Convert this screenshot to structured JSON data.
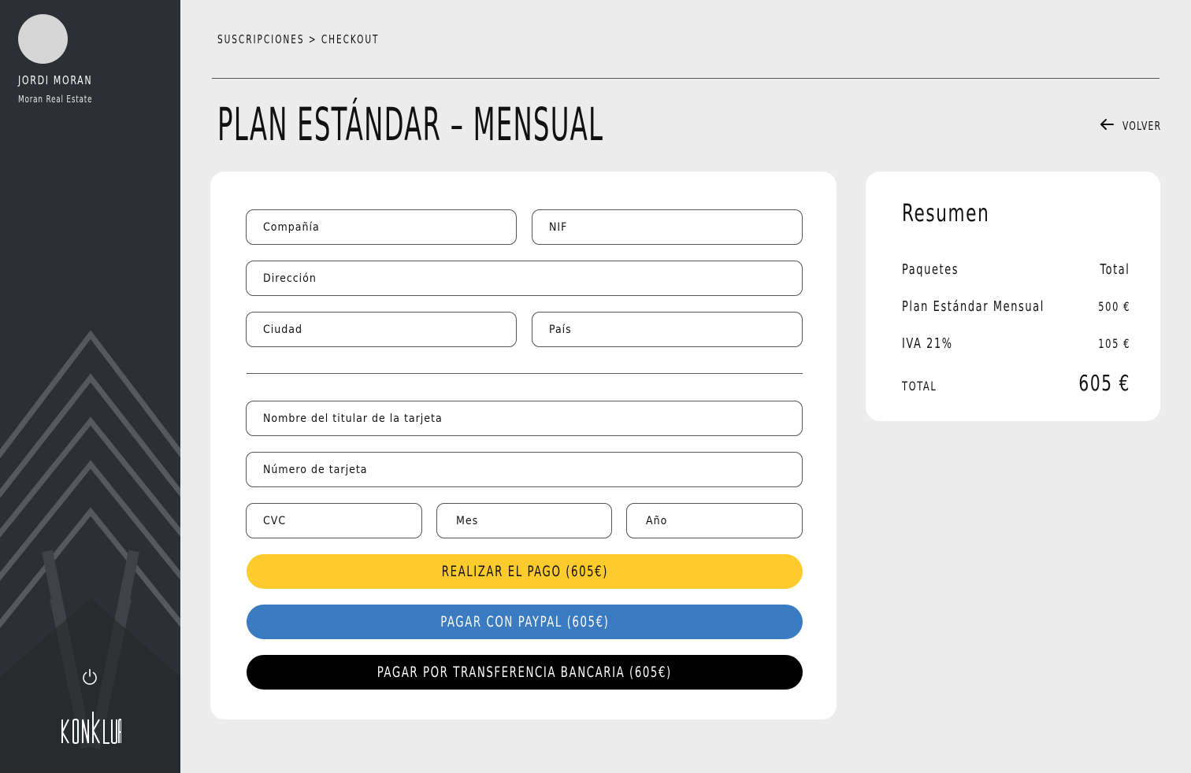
{
  "sidebar": {
    "user_name": "JORDI MORAN",
    "company": "Moran Real Estate",
    "logo_text": "KONKLUA",
    "icons": {
      "power": "power-icon"
    }
  },
  "header": {
    "breadcrumb": "SUSCRIPCIONES > CHECKOUT",
    "title": "PLAN ESTÁNDAR – MENSUAL",
    "back_label": "VOLVER",
    "back_icon": "arrow-left-icon"
  },
  "form": {
    "company_placeholder": "Compañía",
    "nif_placeholder": "NIF",
    "address_placeholder": "Dirección",
    "city_placeholder": "Ciudad",
    "country_placeholder": "País",
    "cardholder_placeholder": "Nombre del titular de la tarjeta",
    "card_number_placeholder": "Número de tarjeta",
    "cvc_placeholder": "CVC",
    "month_placeholder": "Mes",
    "year_placeholder": "Año"
  },
  "buttons": {
    "pay": "REALIZAR EL PAGO (605€)",
    "paypal": "PAGAR CON PAYPAL (605€)",
    "transfer": "PAGAR POR TRANSFERENCIA BANCARIA (605€)"
  },
  "colors": {
    "pay": "#fdcb2e",
    "paypal": "#3b7bc2",
    "transfer": "#000000",
    "sidebar": "#2c2f33",
    "background": "#ececec"
  },
  "summary": {
    "title": "Resumen",
    "header_left": "Paquetes",
    "header_right": "Total",
    "rows": [
      {
        "label": "Plan Estándar Mensual",
        "value": "500 €"
      },
      {
        "label": "IVA 21%",
        "value": "105 €"
      }
    ],
    "total_label": "TOTAL",
    "total_value": "605 €"
  }
}
